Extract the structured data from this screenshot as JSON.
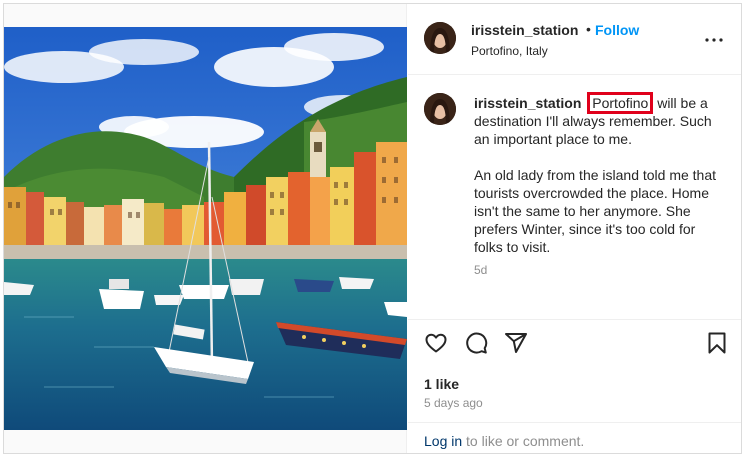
{
  "post": {
    "username": "irisstein_station",
    "separator": "•",
    "follow_label": "Follow",
    "location": "Portofino, Italy",
    "caption_highlight": "Portofino",
    "caption_rest": " will be a destination I'll always remember. Such an important place to me.",
    "caption_para2": "An old lady from the island told me that tourists overcrowded the place. Home isn't the same to her anymore. She prefers Winter, since it's too cold for folks to visit.",
    "comment_time": "5d",
    "likes": "1 like",
    "posted_ago": "5 days ago",
    "login_link": "Log in",
    "login_rest": " to like or comment."
  },
  "icons": {
    "more": "more-options-icon",
    "like": "heart-icon",
    "comment": "comment-icon",
    "share": "share-icon",
    "save": "bookmark-icon"
  },
  "colors": {
    "accent": "#0095f6",
    "highlight_box": "#e0001b",
    "link": "#00376b",
    "muted": "#8e8e8e"
  }
}
